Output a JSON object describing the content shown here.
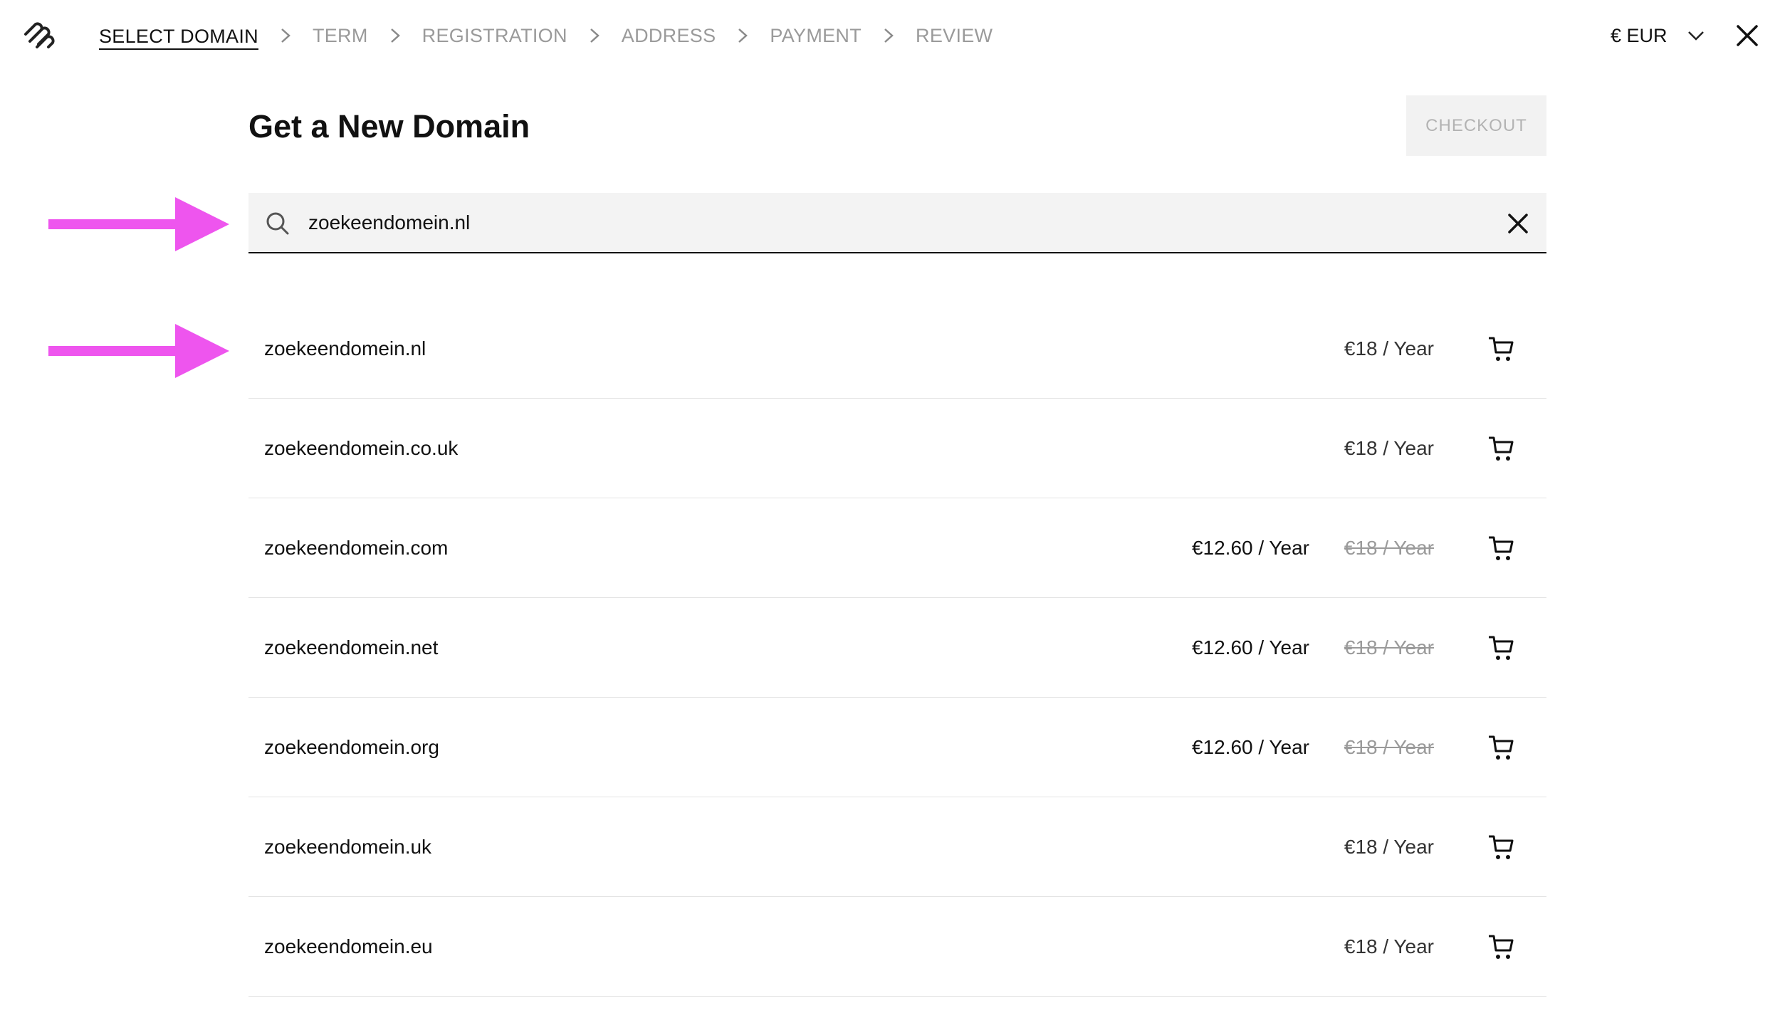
{
  "nav": {
    "steps": [
      {
        "label": "SELECT DOMAIN",
        "active": true
      },
      {
        "label": "TERM",
        "active": false
      },
      {
        "label": "REGISTRATION",
        "active": false
      },
      {
        "label": "ADDRESS",
        "active": false
      },
      {
        "label": "PAYMENT",
        "active": false
      },
      {
        "label": "REVIEW",
        "active": false
      }
    ],
    "currency": "€ EUR"
  },
  "header": {
    "title": "Get a New Domain",
    "checkout_label": "CHECKOUT"
  },
  "search": {
    "value": "zoekeendomein.nl"
  },
  "results": [
    {
      "domain": "zoekeendomein.nl",
      "sale_price": "",
      "price": "€18 / Year",
      "struck": false
    },
    {
      "domain": "zoekeendomein.co.uk",
      "sale_price": "",
      "price": "€18 / Year",
      "struck": false
    },
    {
      "domain": "zoekeendomein.com",
      "sale_price": "€12.60 / Year",
      "price": "€18 / Year",
      "struck": true
    },
    {
      "domain": "zoekeendomein.net",
      "sale_price": "€12.60 / Year",
      "price": "€18 / Year",
      "struck": true
    },
    {
      "domain": "zoekeendomein.org",
      "sale_price": "€12.60 / Year",
      "price": "€18 / Year",
      "struck": true
    },
    {
      "domain": "zoekeendomein.uk",
      "sale_price": "",
      "price": "€18 / Year",
      "struck": false
    },
    {
      "domain": "zoekeendomein.eu",
      "sale_price": "",
      "price": "€18 / Year",
      "struck": false
    }
  ],
  "colors": {
    "annotation_arrow": "#ee55ee",
    "inactive_step": "#9a9a9a",
    "checkout_bg": "#f2f2f2",
    "search_bg": "#f3f3f3"
  },
  "icons": {
    "logo": "squarespace-logo-icon",
    "step_separator": "chevron-right-icon",
    "currency_toggle": "chevron-down-icon",
    "close": "close-icon",
    "search": "search-icon",
    "clear": "clear-icon",
    "cart": "cart-icon",
    "annotation": "arrow-right-icon"
  }
}
